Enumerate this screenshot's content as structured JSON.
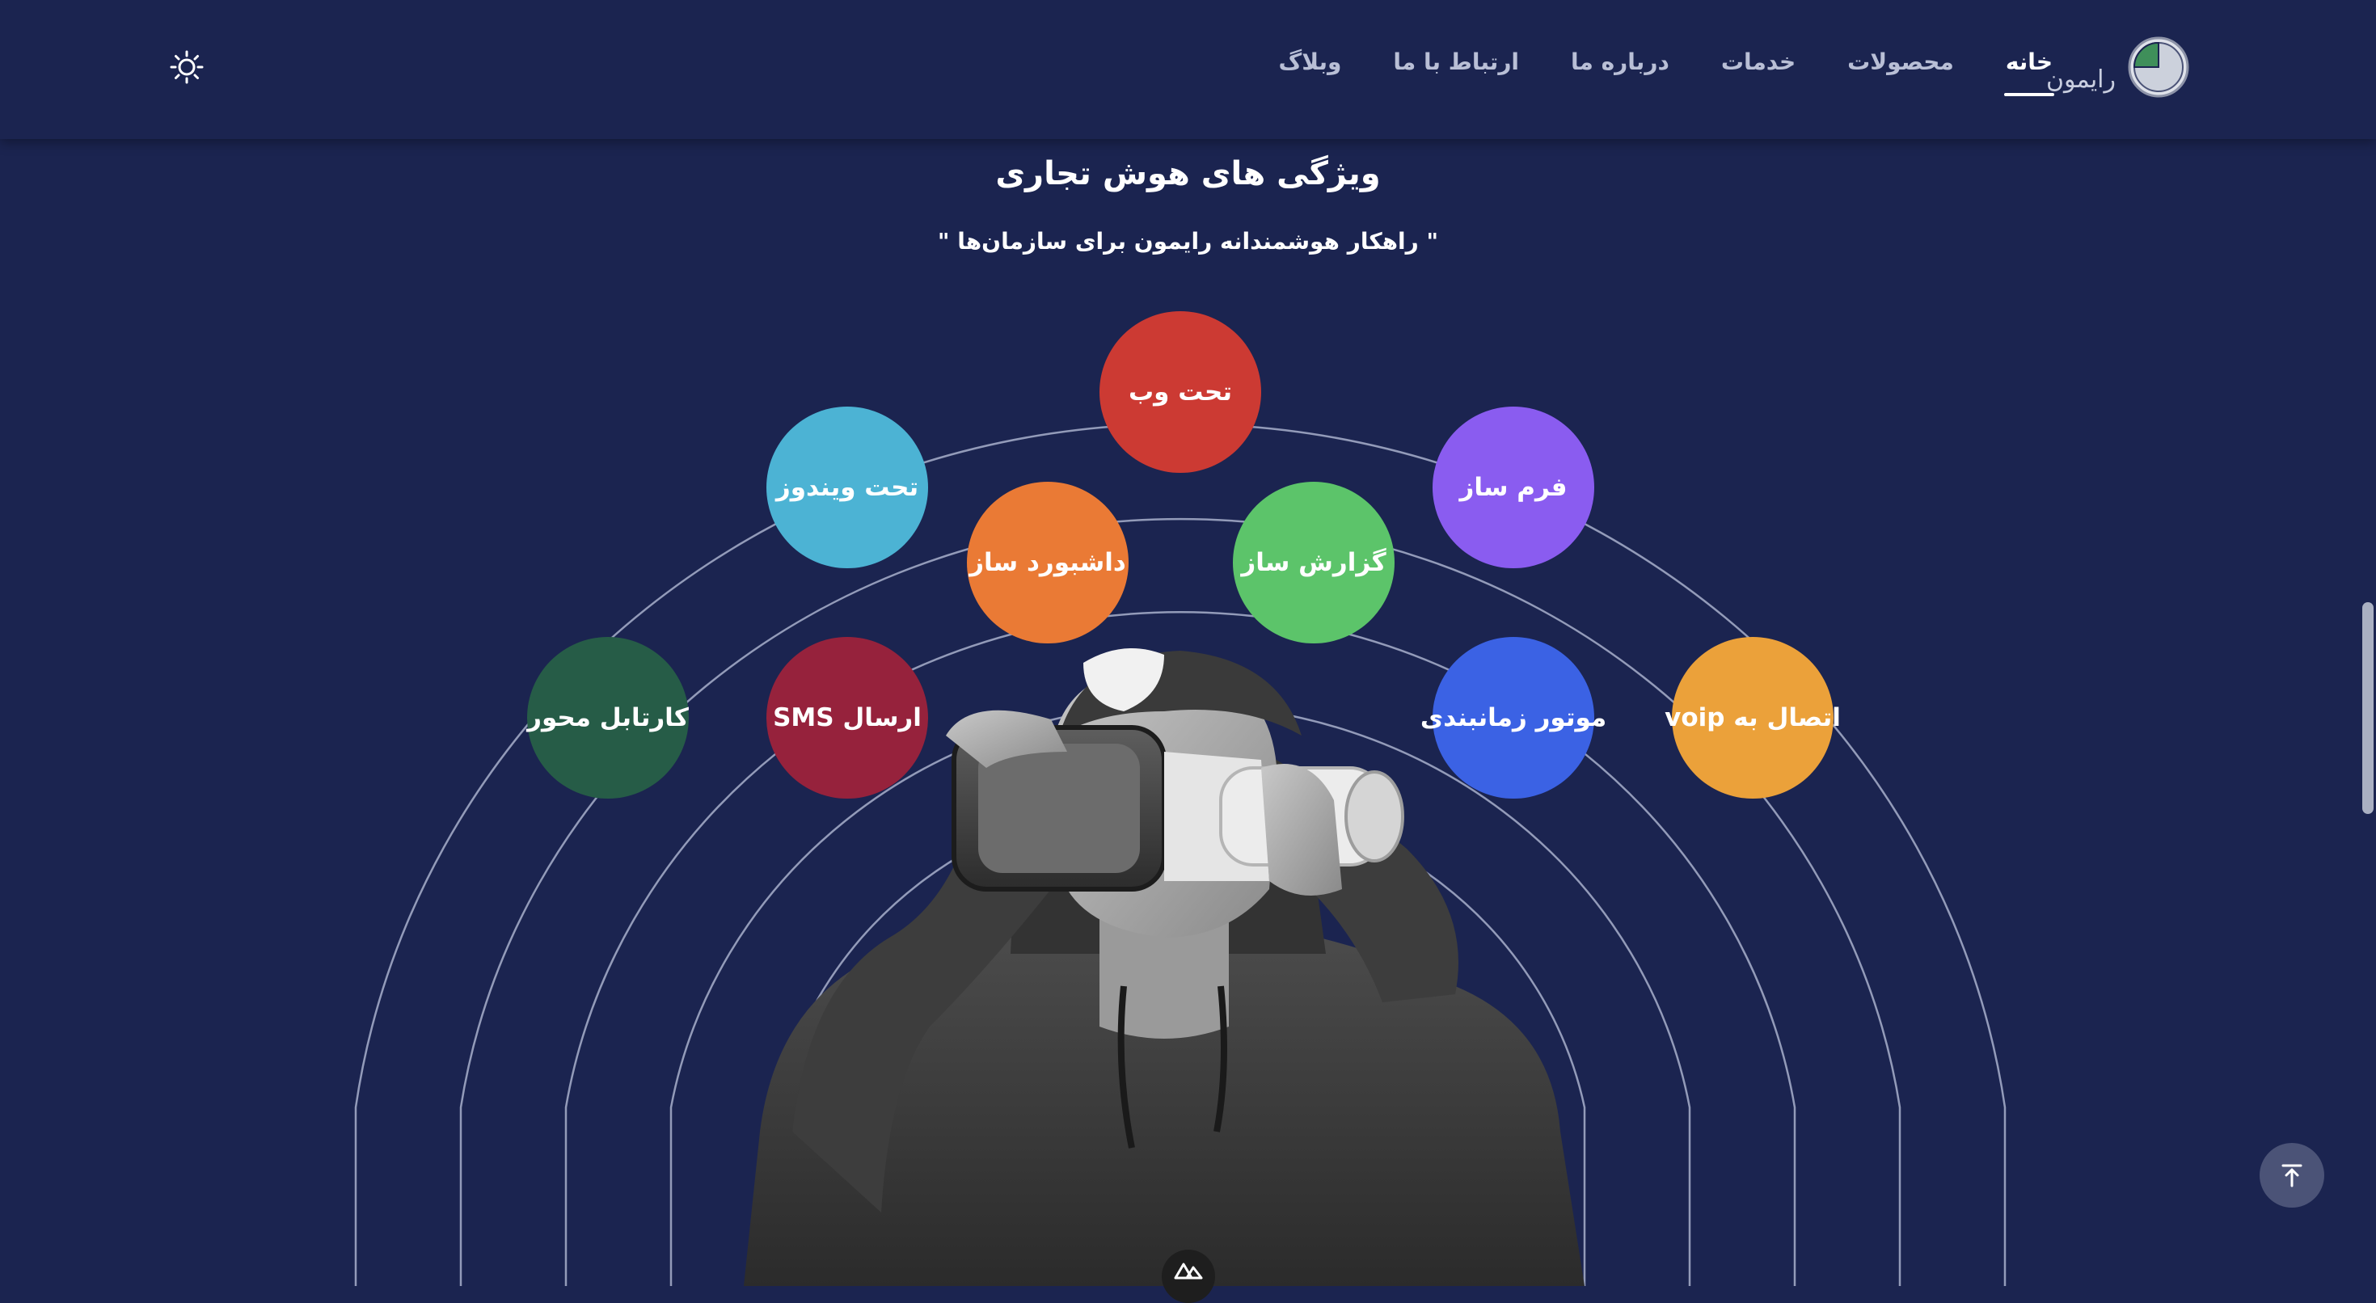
{
  "header": {
    "brand_name": "رایمون",
    "brand_logo_icon": "pie-chart-logo-icon",
    "theme_toggle_icon": "sun-icon",
    "nav": [
      {
        "label": "خانه",
        "active": true
      },
      {
        "label": "محصولات",
        "active": false
      },
      {
        "label": "خدمات",
        "active": false
      },
      {
        "label": "درباره ما",
        "active": false
      },
      {
        "label": "ارتباط با ما",
        "active": false
      },
      {
        "label": "وبلاگ",
        "active": false
      }
    ]
  },
  "section": {
    "title": "ویژگی های هوش تجاری",
    "subtitle": "\" راهکار هوشمندانه رایمون برای سازمان‌ها \""
  },
  "features": [
    {
      "label": "تحت وب",
      "color": "#cc3a33"
    },
    {
      "label": "تحت ویندوز",
      "color": "#4cb3d4"
    },
    {
      "label": "فرم ساز",
      "color": "#8a5cf0"
    },
    {
      "label": "داشبورد ساز",
      "color": "#ea7a35"
    },
    {
      "label": "گزارش ساز",
      "color": "#5cc46a"
    },
    {
      "label": "کارتابل محور",
      "color": "#265c47"
    },
    {
      "label": "ارسال SMS",
      "color": "#96223c"
    },
    {
      "label": "موتور زمانبندی",
      "color": "#3b62e4"
    },
    {
      "label": "اتصال به voip",
      "color": "#eba13a"
    }
  ],
  "colors": {
    "background": "#1b2450",
    "arc_stroke": "#a8b0cc",
    "nav_active": "#ffffff",
    "nav_inactive": "#b9bfd6"
  },
  "floating": {
    "scroll_top_icon": "arrow-up-to-line-icon",
    "framework_badge_icon": "nuxt-logo-icon"
  }
}
